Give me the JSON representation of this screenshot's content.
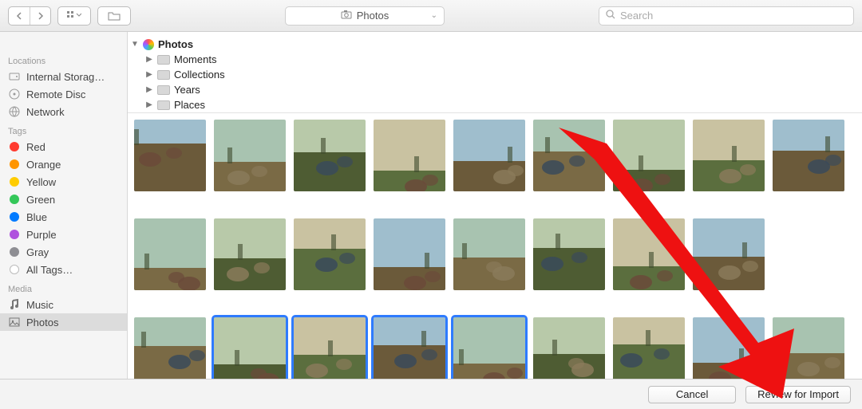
{
  "toolbar": {
    "title": "Photos",
    "search_placeholder": "Search"
  },
  "sidebar": {
    "truncated_top": "…",
    "sections": [
      {
        "heading": "Locations",
        "items": [
          {
            "label": "Internal Storag…",
            "icon": "hdd"
          },
          {
            "label": "Remote Disc",
            "icon": "disc"
          },
          {
            "label": "Network",
            "icon": "globe"
          }
        ]
      },
      {
        "heading": "Tags",
        "items": [
          {
            "label": "Red",
            "color": "#ff3b30"
          },
          {
            "label": "Orange",
            "color": "#ff9500"
          },
          {
            "label": "Yellow",
            "color": "#ffcc00"
          },
          {
            "label": "Green",
            "color": "#34c759"
          },
          {
            "label": "Blue",
            "color": "#007aff"
          },
          {
            "label": "Purple",
            "color": "#af52de"
          },
          {
            "label": "Gray",
            "color": "#8e8e93"
          },
          {
            "label": "All Tags…",
            "color": null
          }
        ]
      },
      {
        "heading": "Media",
        "items": [
          {
            "label": "Music",
            "icon": "music"
          },
          {
            "label": "Photos",
            "icon": "photos",
            "selected": true
          }
        ]
      }
    ]
  },
  "tree": {
    "root": "Photos",
    "children": [
      "Moments",
      "Collections",
      "Years",
      "Places"
    ]
  },
  "grid": {
    "rows": [
      {
        "count": 9,
        "selected": []
      },
      {
        "count": 8,
        "selected": []
      },
      {
        "count": 9,
        "selected": [
          1,
          2,
          3,
          4
        ]
      }
    ]
  },
  "footer": {
    "cancel": "Cancel",
    "confirm": "Review for Import"
  }
}
